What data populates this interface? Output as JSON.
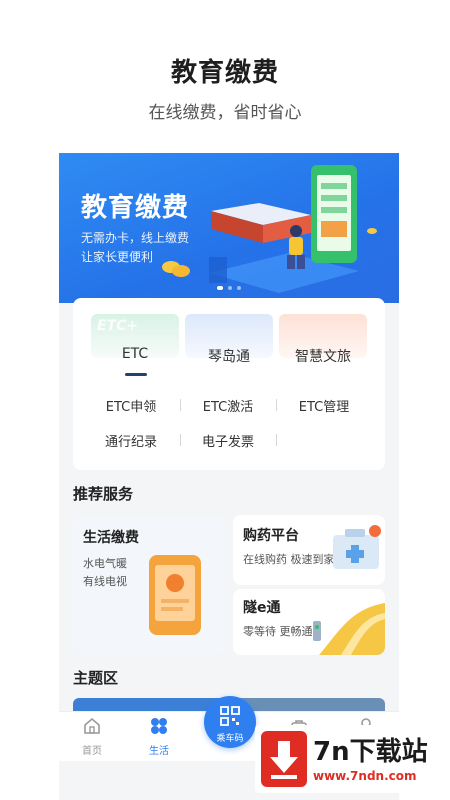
{
  "hero": {
    "title": "教育缴费",
    "subtitle": "在线缴费，省时省心"
  },
  "banner": {
    "title": "教育缴费",
    "line1": "无需办卡，线上缴费",
    "line2": "让家长更便利",
    "slide_count": 3,
    "active_slide": 1
  },
  "top_tabs": [
    {
      "label": "ETC",
      "ghost": "ETC+"
    },
    {
      "label": "琴岛通"
    },
    {
      "label": "智慧文旅"
    }
  ],
  "etc_actions": [
    {
      "label": "ETC申领"
    },
    {
      "label": "ETC激活"
    },
    {
      "label": "ETC管理"
    },
    {
      "label": "通行纪录"
    },
    {
      "label": "电子发票"
    }
  ],
  "recommend": {
    "title": "推荐服务",
    "life": {
      "title": "生活缴费",
      "desc1": "水电气暖",
      "desc2": "有线电视"
    },
    "medicine": {
      "title": "购药平台",
      "desc": "在线购药 极速到家"
    },
    "tunnel": {
      "title": "隧e通",
      "desc": "零等待 更畅通"
    }
  },
  "theme": {
    "title": "主题区"
  },
  "tabbar": {
    "home": "首页",
    "life": "生活",
    "scan": "乘车码"
  },
  "watermark": {
    "name": "7n下载站",
    "url": "www.7ndn.com"
  },
  "colors": {
    "accent": "#2f7ff0",
    "banner_blue": "#2572e8",
    "watermark_red": "#e02d24"
  }
}
